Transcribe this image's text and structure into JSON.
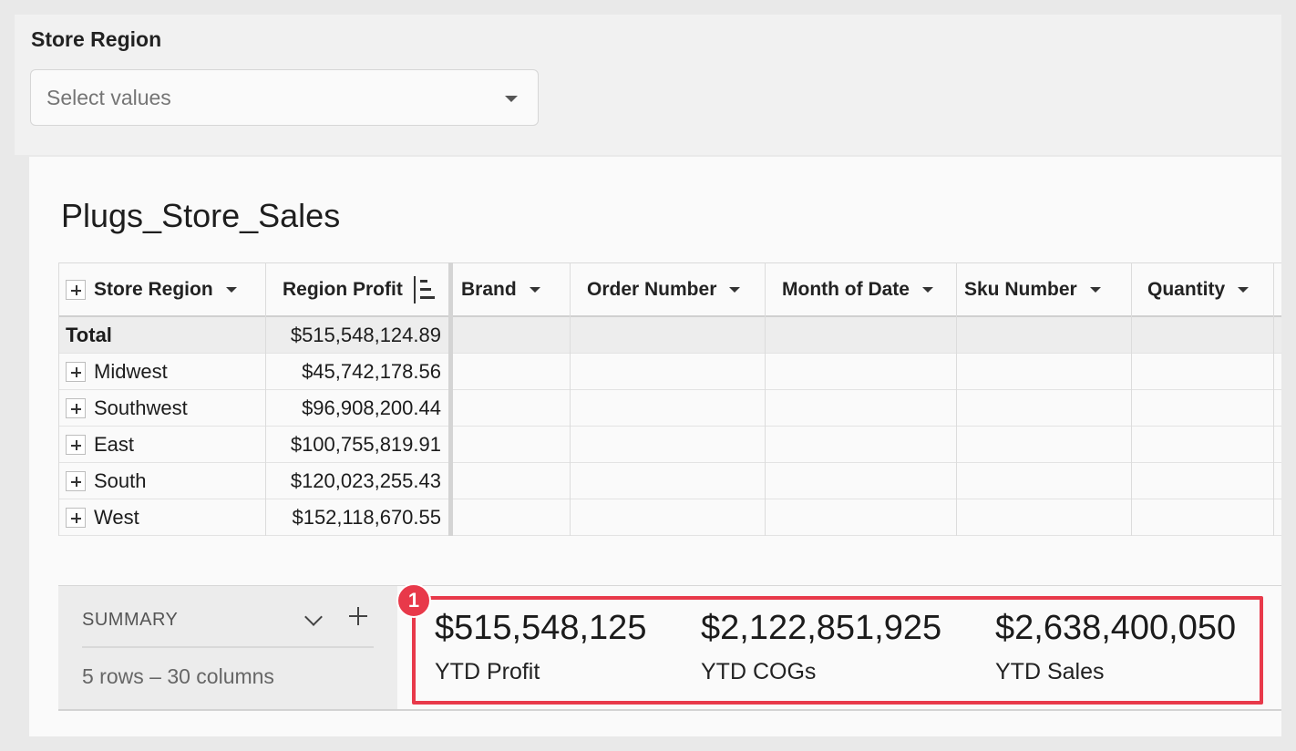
{
  "control": {
    "title": "Store Region",
    "placeholder": "Select values"
  },
  "panel": {
    "title": "Plugs_Store_Sales"
  },
  "table": {
    "columns": [
      "Store Region",
      "Region Profit",
      "Brand",
      "Order Number",
      "Month of Date",
      "Sku Number",
      "Quantity"
    ],
    "total": {
      "label": "Total",
      "value": "$515,548,124.89"
    },
    "rows": [
      {
        "label": "Midwest",
        "value": "$45,742,178.56"
      },
      {
        "label": "Southwest",
        "value": "$96,908,200.44"
      },
      {
        "label": "East",
        "value": "$100,755,819.91"
      },
      {
        "label": "South",
        "value": "$120,023,255.43"
      },
      {
        "label": "West",
        "value": "$152,118,670.55"
      }
    ]
  },
  "summary": {
    "label": "SUMMARY",
    "count": "5 rows – 30 columns"
  },
  "kpis": [
    {
      "value": "$515,548,125",
      "label": "YTD Profit"
    },
    {
      "value": "$2,122,851,925",
      "label": "YTD COGs"
    },
    {
      "value": "$2,638,400,050",
      "label": "YTD Sales"
    }
  ],
  "annotation": {
    "badge": "1",
    "color": "#e8394a"
  }
}
